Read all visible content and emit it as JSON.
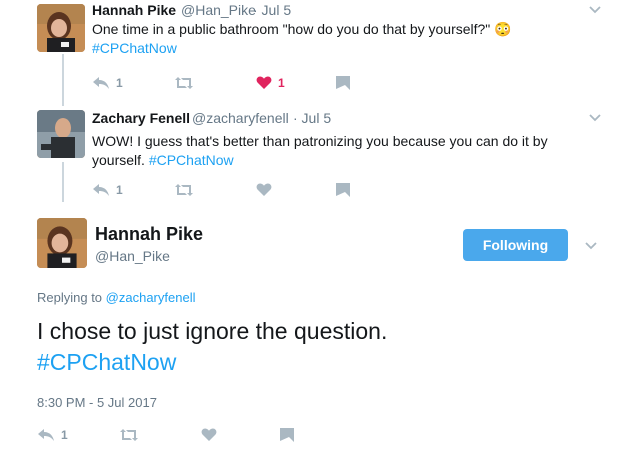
{
  "tweets": [
    {
      "name": "Hannah Pike",
      "handle": "@Han_Pike",
      "date": "· Jul 5",
      "text": "One time in a public bathroom \"how do you do that by yourself?\"",
      "emoji": "😳",
      "hashtag": "#CPChatNow",
      "reply_count": "1",
      "like_count": "1"
    },
    {
      "name": "Zachary Fenell",
      "handle": "@zacharyfenell",
      "date": "· Jul 5",
      "text_line1": "WOW! I guess that's better than patronizing you because you can do it by",
      "text_line2": "yourself.",
      "hashtag": "#CPChatNow",
      "reply_count": "1"
    }
  ],
  "main_tweet": {
    "name": "Hannah Pike",
    "handle": "@Han_Pike",
    "follow_label": "Following",
    "replying_prefix": "Replying to",
    "replying_handle": "@zacharyfenell",
    "text": "I chose to just ignore the question.",
    "hashtag": "#CPChatNow",
    "timestamp": "8:30 PM - 5 Jul 2017",
    "reply_count": "1"
  },
  "colors": {
    "link": "#1da1f2",
    "like_active": "#e0245e",
    "icon_gray": "#aab8c2",
    "follow_bg": "#4aa8ec"
  },
  "icons": [
    "reply-icon",
    "retweet-icon",
    "heart-icon",
    "direct-message-icon",
    "chevron-down-icon"
  ]
}
